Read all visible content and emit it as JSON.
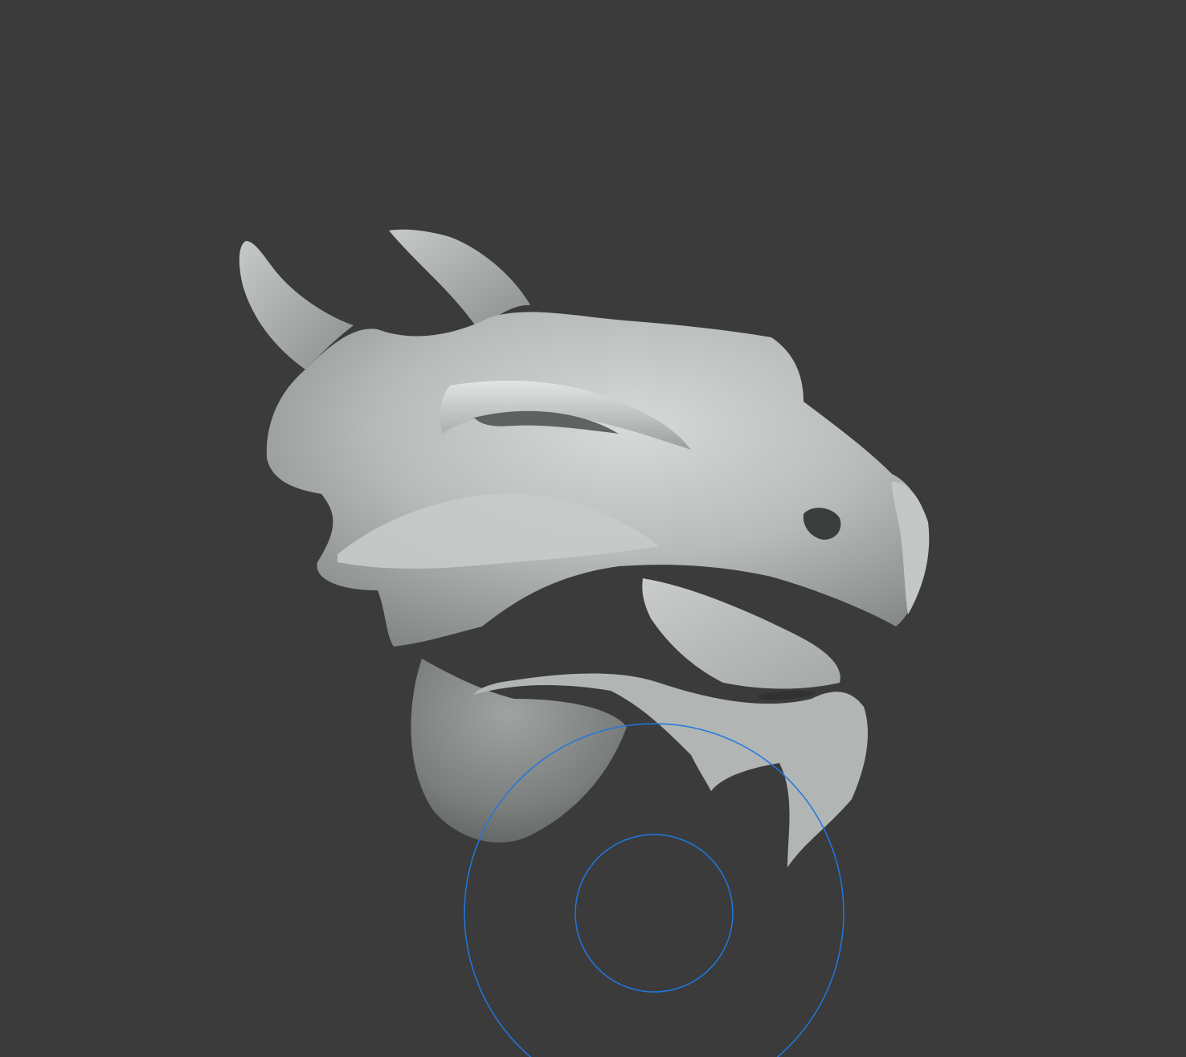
{
  "viewport": {
    "background_color": "#3b3b3b",
    "mode": "sculpt"
  },
  "model": {
    "subject": "dragon-head-sculpt",
    "base_color": "#a9acac"
  },
  "brush_cursor": {
    "color": "#1f78e0",
    "rings": 2
  }
}
